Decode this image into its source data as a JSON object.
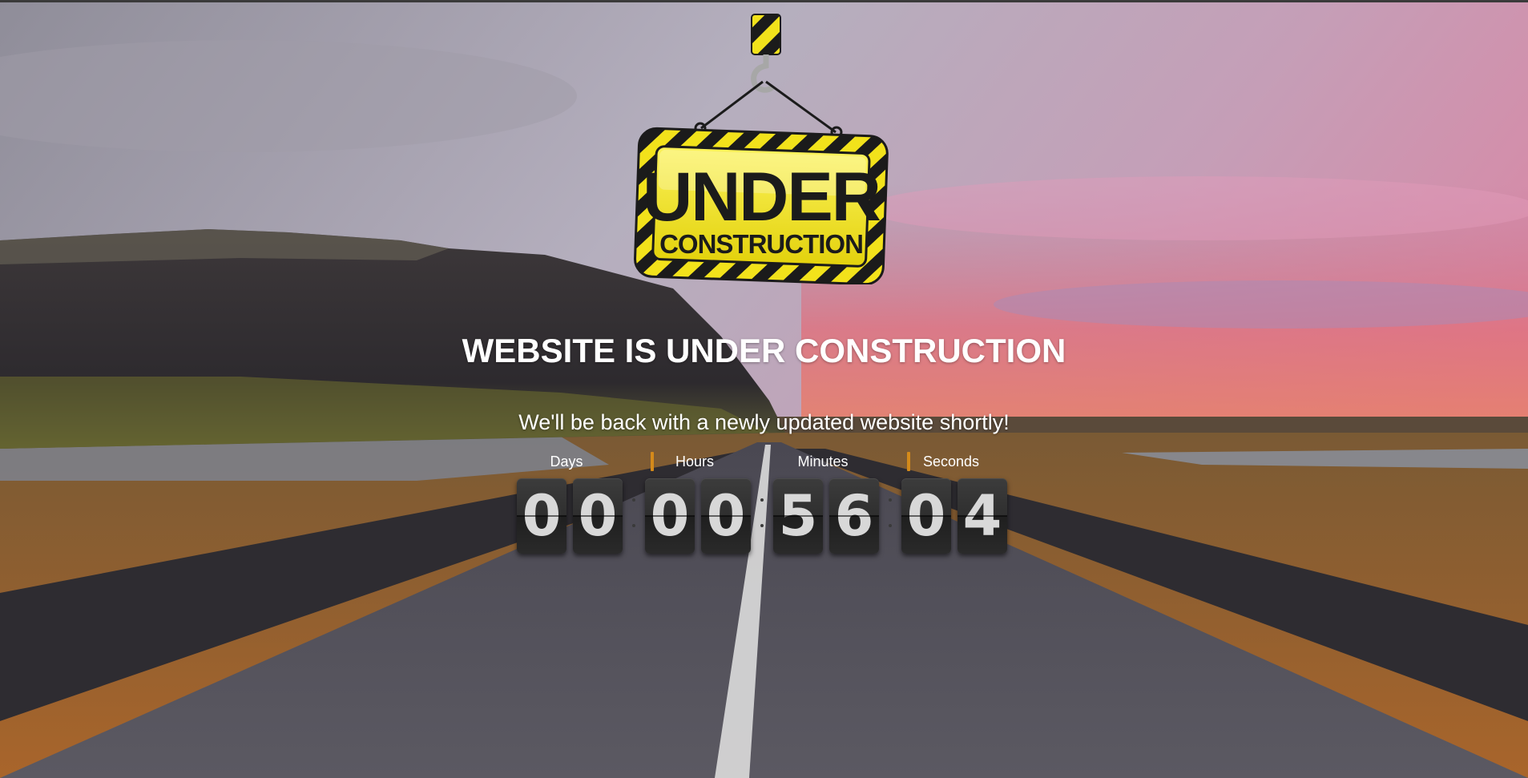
{
  "page": {
    "headline": "WEBSITE IS UNDER CONSTRUCTION",
    "subline": "We'll be back with a newly updated website shortly!"
  },
  "sign": {
    "line1": "UNDER",
    "line2": "CONSTRUCTION",
    "colors": {
      "yellow": "#f2e21b",
      "black": "#1b1b1b"
    }
  },
  "countdown": {
    "units": [
      {
        "label": "Days",
        "digits": [
          "0",
          "0"
        ]
      },
      {
        "label": "Hours",
        "digits": [
          "0",
          "0"
        ]
      },
      {
        "label": "Minutes",
        "digits": [
          "5",
          "6"
        ]
      },
      {
        "label": "Seconds",
        "digits": [
          "0",
          "4"
        ]
      }
    ],
    "accent_color": "#d48a1a"
  }
}
